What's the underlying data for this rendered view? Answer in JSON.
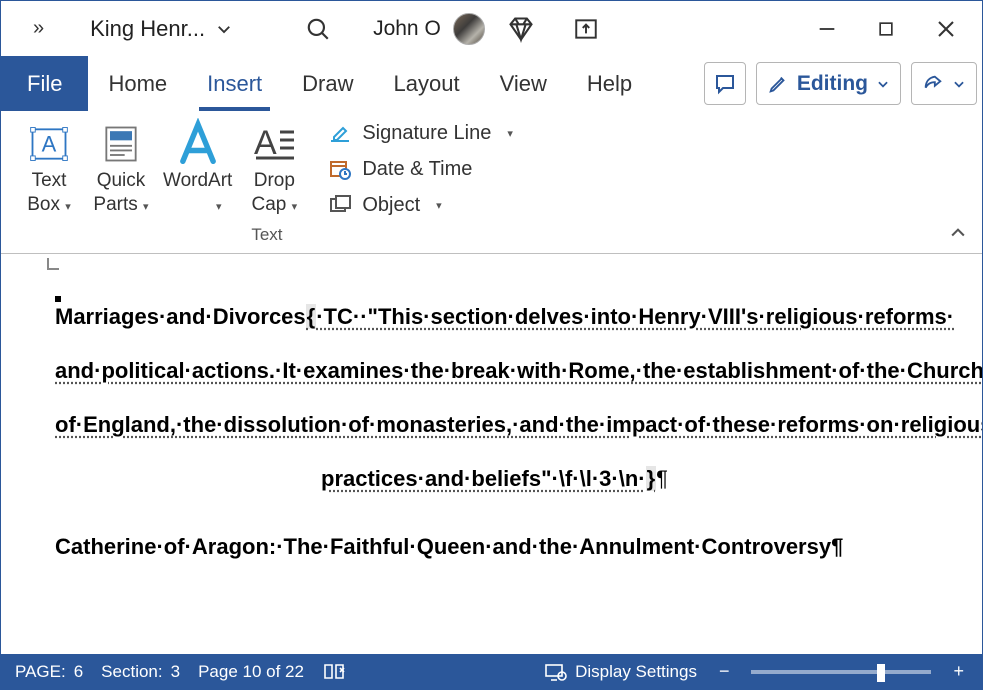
{
  "titlebar": {
    "doc_title": "King Henr...",
    "user_name": "John O"
  },
  "tabs": {
    "file": "File",
    "home": "Home",
    "insert": "Insert",
    "draw": "Draw",
    "layout": "Layout",
    "view": "View",
    "help": "Help",
    "editing": "Editing"
  },
  "ribbon": {
    "text_box": "Text\nBox",
    "quick_parts": "Quick\nParts",
    "wordart": "WordArt",
    "drop_cap": "Drop\nCap",
    "signature_line": "Signature Line",
    "date_time": "Date & Time",
    "object": "Object",
    "group_label": "Text"
  },
  "document": {
    "heading_lead": "Marriages·and·Divorces",
    "field_open": "{",
    "tc_label": "·TC·",
    "tc_body_1": "·\"This·section·delves·into·Henry·VIII's·religious·reforms·",
    "tc_body_2": "and·political·actions.·It·examines·the·break·with·Rome,·the·establishment·of·the·Church·",
    "tc_body_3": "of·England,·the·dissolution·of·monasteries,·and·the·impact·of·these·reforms·on·religious·",
    "tc_body_4": "practices·and·beliefs\"·\\f·\\l·3·\\n·",
    "field_close": "}",
    "pilcrow": "¶",
    "sub_heading": "Catherine·of·Aragon:·The·Faithful·Queen·and·the·Annulment·Controversy¶"
  },
  "status": {
    "page_label": "PAGE:",
    "page_num": "6",
    "section_label": "Section:",
    "section_num": "3",
    "page_of": "Page 10 of 22",
    "display_settings": "Display Settings"
  }
}
